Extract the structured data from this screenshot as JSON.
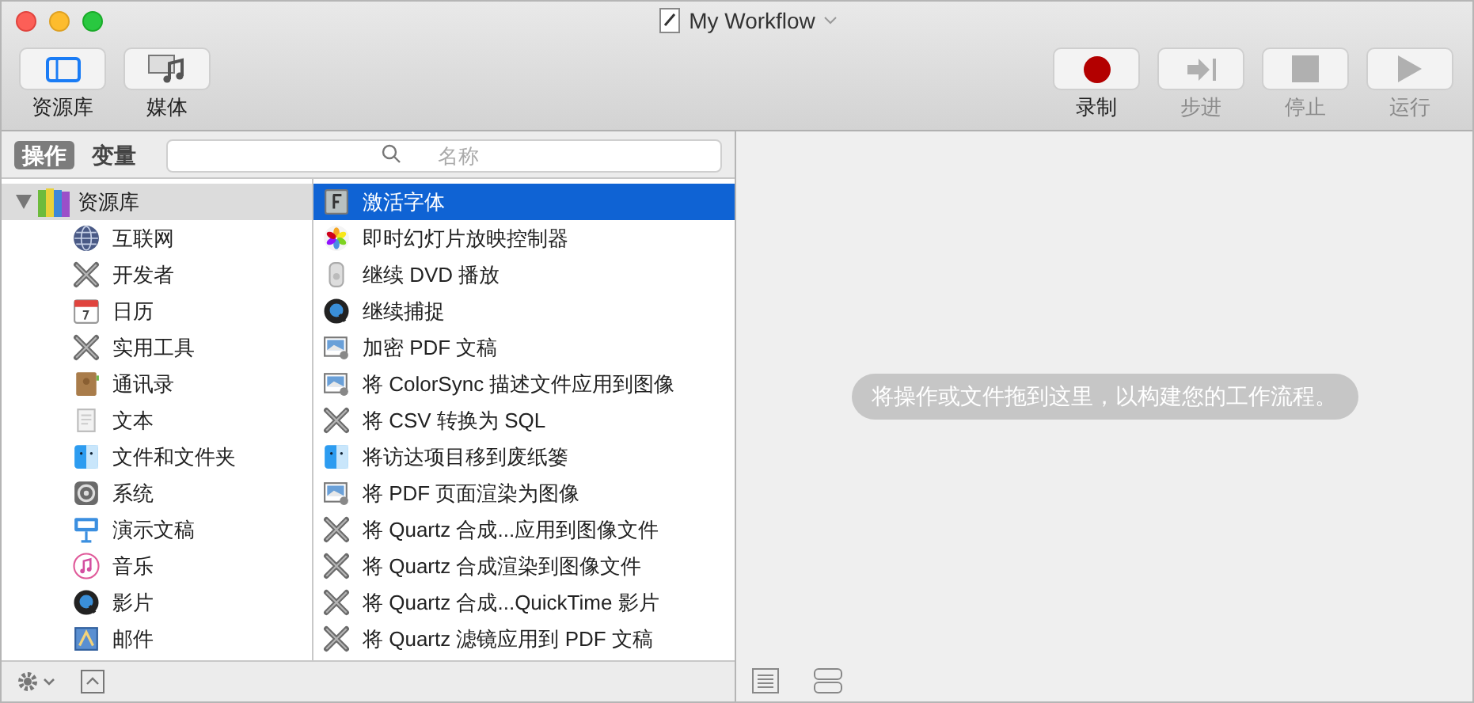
{
  "window": {
    "title": "My Workflow"
  },
  "toolbar_left": [
    {
      "label": "资源库",
      "kind": "library"
    },
    {
      "label": "媒体",
      "kind": "media"
    }
  ],
  "toolbar_right": [
    {
      "label": "录制",
      "kind": "record",
      "disabled": false
    },
    {
      "label": "步进",
      "kind": "step",
      "disabled": true
    },
    {
      "label": "停止",
      "kind": "stop",
      "disabled": true
    },
    {
      "label": "运行",
      "kind": "run",
      "disabled": true
    }
  ],
  "tabs": [
    {
      "label": "操作",
      "selected": true
    },
    {
      "label": "变量",
      "selected": false
    }
  ],
  "search": {
    "placeholder": "名称"
  },
  "sidebar": {
    "label": "资源库",
    "expanded": true,
    "selected": true,
    "children": [
      {
        "label": "互联网",
        "kind": "globe"
      },
      {
        "label": "开发者",
        "kind": "tools"
      },
      {
        "label": "日历",
        "kind": "calendar"
      },
      {
        "label": "实用工具",
        "kind": "tools"
      },
      {
        "label": "通讯录",
        "kind": "contacts"
      },
      {
        "label": "文本",
        "kind": "text"
      },
      {
        "label": "文件和文件夹",
        "kind": "finder"
      },
      {
        "label": "系统",
        "kind": "system"
      },
      {
        "label": "演示文稿",
        "kind": "keynote"
      },
      {
        "label": "音乐",
        "kind": "music"
      },
      {
        "label": "影片",
        "kind": "quicktime"
      },
      {
        "label": "邮件",
        "kind": "mail"
      }
    ]
  },
  "actions": [
    {
      "label": "激活字体",
      "kind": "font",
      "selected": true
    },
    {
      "label": "即时幻灯片放映控制器",
      "kind": "photos",
      "selected": false
    },
    {
      "label": "继续 DVD 播放",
      "kind": "dvd",
      "selected": false
    },
    {
      "label": "继续捕捉",
      "kind": "quicktime",
      "selected": false
    },
    {
      "label": "加密 PDF 文稿",
      "kind": "preview",
      "selected": false
    },
    {
      "label": "将 ColorSync 描述文件应用到图像",
      "kind": "preview",
      "selected": false
    },
    {
      "label": "将 CSV 转换为 SQL",
      "kind": "tools",
      "selected": false
    },
    {
      "label": "将访达项目移到废纸篓",
      "kind": "finder",
      "selected": false
    },
    {
      "label": "将 PDF 页面渲染为图像",
      "kind": "preview",
      "selected": false
    },
    {
      "label": "将 Quartz 合成...应用到图像文件",
      "kind": "tools",
      "selected": false
    },
    {
      "label": "将 Quartz 合成渲染到图像文件",
      "kind": "tools",
      "selected": false
    },
    {
      "label": "将 Quartz 合成...QuickTime 影片",
      "kind": "tools",
      "selected": false
    },
    {
      "label": "将 Quartz 滤镜应用到 PDF 文稿",
      "kind": "tools",
      "selected": false
    }
  ],
  "workflow_hint": "将操作或文件拖到这里，以构建您的工作流程。"
}
